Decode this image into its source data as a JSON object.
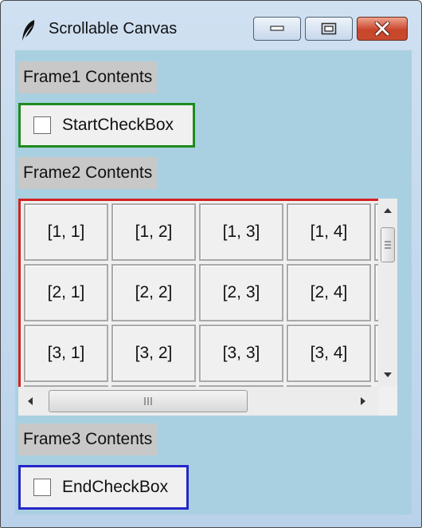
{
  "window": {
    "title": "Scrollable Canvas",
    "icon": "feather-icon",
    "buttons": [
      "minimize-icon",
      "maximize-icon",
      "close-icon"
    ]
  },
  "frame1": {
    "label": "Frame1 Contents",
    "checkbox": {
      "label": "StartCheckBox",
      "checked": false,
      "border_color": "#1f8a1f"
    }
  },
  "frame2": {
    "label": "Frame2 Contents",
    "border_color": "#d22222",
    "cells": [
      [
        "[1, 1]",
        "[1, 2]",
        "[1, 3]",
        "[1, 4]"
      ],
      [
        "[2, 1]",
        "[2, 2]",
        "[2, 3]",
        "[2, 4]"
      ],
      [
        "[3, 1]",
        "[3, 2]",
        "[3, 3]",
        "[3, 4]"
      ]
    ]
  },
  "frame3": {
    "label": "Frame3 Contents",
    "checkbox": {
      "label": "EndCheckBox",
      "checked": false,
      "border_color": "#2626c8"
    }
  },
  "colors": {
    "client_background": "#a9d0e0",
    "label_background": "#c8c8c8"
  }
}
